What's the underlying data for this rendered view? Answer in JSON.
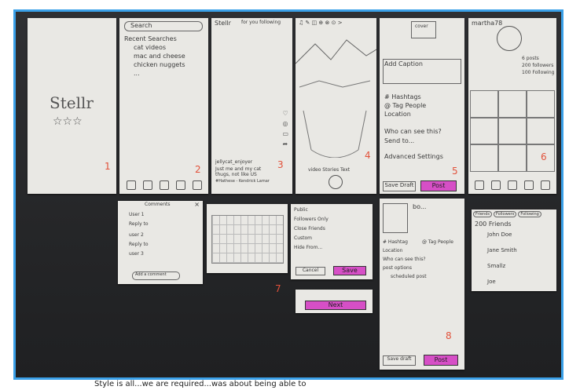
{
  "frame_color": "#3aa0e8",
  "highlight_color": "#d64fc6",
  "number_color": "#e2513a",
  "s1": {
    "title": "Stellr",
    "stars": "☆☆☆",
    "num": "1"
  },
  "s2": {
    "search": "Search",
    "heading": "Recent Searches",
    "items": [
      "cat videos",
      "mac and cheese",
      "chicken nuggets",
      "..."
    ],
    "num": "2"
  },
  "s3": {
    "header": "Stellr",
    "tabs": "for you  following",
    "user": "jellycat_enjoyer",
    "caption": "Just me and my cat thugs, not like US",
    "tags": "#Hathese - Kendrick Lamar",
    "num": "3"
  },
  "s4": {
    "toolbar": "♫ ✎ ◫ ⊕ ⊗ ⊙ >",
    "label": "video    Stories  Text",
    "num": "4"
  },
  "s5": {
    "cover": "cover",
    "caption": "Add Caption",
    "rows": [
      "# Hashtags",
      "@ Tag People",
      "Location"
    ],
    "who": "Who can see this?",
    "send": "Send to...",
    "adv": "Advanced Settings",
    "draft": "Save Draft",
    "post": "Post",
    "num": "5"
  },
  "s6": {
    "user": "martha78",
    "stats": [
      "6 posts",
      "200 followers",
      "100 Following"
    ],
    "num": "6"
  },
  "s7": {
    "title": "Comments",
    "rows": [
      "User 1",
      "Reply to",
      "user 2",
      "Reply to",
      "user 3"
    ],
    "add": "Add a comment"
  },
  "s9": {
    "options": [
      "Public",
      "Followers Only",
      "Close Friends",
      "Custom",
      "Hide From..."
    ],
    "cancel": "Cancel",
    "save": "Save",
    "next": "Next",
    "num": "7"
  },
  "s10": {
    "text": "bo...",
    "row1a": "# Hashtag",
    "row1b": "@ Tag People",
    "loc": "Location",
    "who": "Who can see this?",
    "opts": "post options",
    "sched": "scheduled post",
    "draft": "Save draft",
    "post": "Post",
    "num": "8"
  },
  "s11": {
    "tabs": [
      "Friends",
      "Followers",
      "Following"
    ],
    "count": "200 Friends",
    "names": [
      "John Doe",
      "Jane Smith",
      "Smallz",
      "Joe"
    ]
  },
  "caption": "Style is all...we are required...was about being able to"
}
